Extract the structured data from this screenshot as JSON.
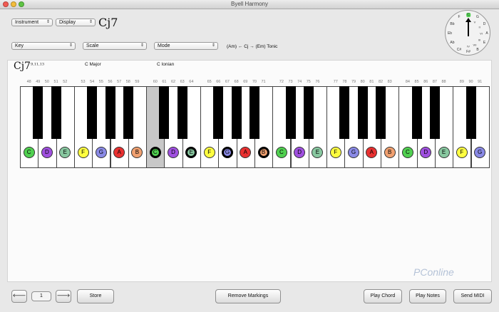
{
  "window": {
    "title": "Byell Harmony"
  },
  "controls": {
    "instrument": "Instrument",
    "display": "Display",
    "key": "Key",
    "scale": "Scale",
    "mode": "Mode"
  },
  "chord": {
    "name": "Cj7",
    "name_small": "Cj7",
    "extensions": "9,11,13",
    "function_text": "(Am) ← Cj → (Em) Tonic",
    "scale_label": "C Major",
    "mode_label": "C Ionian"
  },
  "wheel": {
    "labels": [
      "C",
      "G",
      "D",
      "A",
      "E",
      "B",
      "F#",
      "C#",
      "Ab",
      "Eb",
      "Bb",
      "F"
    ],
    "numerals": [
      "I",
      "V",
      "II",
      "VI",
      "III",
      "VII",
      "IV"
    ],
    "highlight": "C"
  },
  "piano": {
    "key_numbers": [
      "48",
      "49",
      "50",
      "51",
      "52",
      "53",
      "54",
      "55",
      "56",
      "57",
      "58",
      "59",
      "60",
      "61",
      "62",
      "63",
      "64",
      "65",
      "66",
      "67",
      "68",
      "69",
      "70",
      "71",
      "72",
      "73",
      "74",
      "75",
      "76",
      "77",
      "78",
      "79",
      "80",
      "81",
      "82",
      "83",
      "84",
      "85",
      "86",
      "87",
      "88",
      "89",
      "90",
      "91"
    ],
    "highlighted_key": "60",
    "white_notes": [
      "C",
      "D",
      "E",
      "F",
      "G",
      "A",
      "B",
      "C",
      "D",
      "E",
      "F",
      "G",
      "A",
      "B",
      "C",
      "D",
      "E",
      "F",
      "G",
      "A",
      "B",
      "C",
      "D",
      "E",
      "F",
      "G"
    ],
    "note_colors": {
      "C": "#50d050",
      "D": "#a050e0",
      "E": "#88c8a0",
      "F": "#ffff40",
      "G": "#8a8ae6",
      "A": "#e83030",
      "B": "#f0a070"
    },
    "marked_indices": [
      7,
      9,
      11,
      13
    ]
  },
  "footer": {
    "prev_icon": "left-arrow-icon",
    "page_number": "1",
    "next_icon": "right-arrow-icon",
    "store": "Store",
    "remove_markings": "Remove Markings",
    "play_chord": "Play Chord",
    "play_notes": "Play Notes",
    "send_midi": "Send MIDI"
  },
  "watermark": "PConline"
}
